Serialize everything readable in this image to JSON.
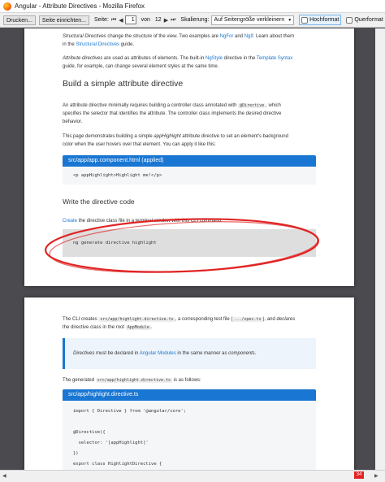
{
  "window": {
    "title": "Angular - Attribute Directives - Mozilla Firefox"
  },
  "toolbar": {
    "print_label": "Drucken...",
    "setup_label": "Seite einrichten...",
    "page_label": "Seite:",
    "first_icon": "first-page-icon",
    "prev_icon": "prev-page-icon",
    "page_value": "1",
    "of_label": "von",
    "total_pages": "12",
    "next_icon": "next-page-icon",
    "last_icon": "last-page-icon",
    "scale_label": "Skalierung:",
    "scale_value": "Auf Seitengröße verkleinern",
    "portrait_label": "Hochformat",
    "landscape_label": "Querformat"
  },
  "page1": {
    "p1": {
      "a": "Structural Directives",
      "b": " change the structure of the view. Two examples are ",
      "c": "NgFor",
      "d": " and ",
      "e": "NgIf",
      "f": ". Learn about them",
      "g": "in the ",
      "h": "Structural Directives",
      "i": " guide."
    },
    "p2": {
      "a": "Attribute directives",
      "b": " are used as attributes of elements. The built-in ",
      "c": "NgStyle",
      "d": " directive in the ",
      "e": "Template Syntax",
      "f": "guide, for example, can change several element styles at the same time."
    },
    "heading1": "Build a simple attribute directive",
    "p3": {
      "a": "An attribute directive minimally requires building a controller class annotated with ",
      "b": "@Directive",
      "c": ", which",
      "d": "specifies the selector that identifies the attribute. The controller class implements the desired directive",
      "e": "behavior."
    },
    "p4": {
      "a": "This page demonstrates building a simple ",
      "b": "appHighlight",
      "c": " attribute directive to set an element's background",
      "d": "color when the user hovers over that element. You can apply it like this:"
    },
    "code1_title": "src/app/app.component.html (applied)",
    "code1_line": "<p appHighlight>Highlight me!</p>",
    "heading2": "Write the directive code",
    "p5": {
      "a": "Create",
      "b": " the directive class file in a terminal window with this CLI command."
    },
    "terminal_cmd": "ng generate directive highlight"
  },
  "page2": {
    "p1": {
      "a": "The CLI creates ",
      "b": "src/app/highlight.directive.ts",
      "c": ", a corresponding test file (",
      "d": ".../spec.ts",
      "e": "), and ",
      "f": "declares",
      "g": "the directive class in the root ",
      "h": "AppModule",
      "i": "."
    },
    "callout": {
      "a": "Directives",
      "b": " must be declared in ",
      "c": "Angular Modules",
      "d": " in the same manner as ",
      "e": "components",
      "f": "."
    },
    "p2": {
      "a": "The generated ",
      "b": "src/app/highlight.directive.ts",
      "c": " is as follows:"
    },
    "code2_title": "src/app/highlight.directive.ts",
    "code2_lines": [
      "import { Directive } from '@angular/core';",
      "",
      "@Directive({",
      "  selector: '[appHighlight]'",
      "})",
      "export class HighlightDirective {"
    ]
  },
  "statusbar": {
    "badge": "34"
  },
  "colors": {
    "accent": "#1976d2",
    "annotation": "#e02424",
    "badge": "#e02424"
  }
}
